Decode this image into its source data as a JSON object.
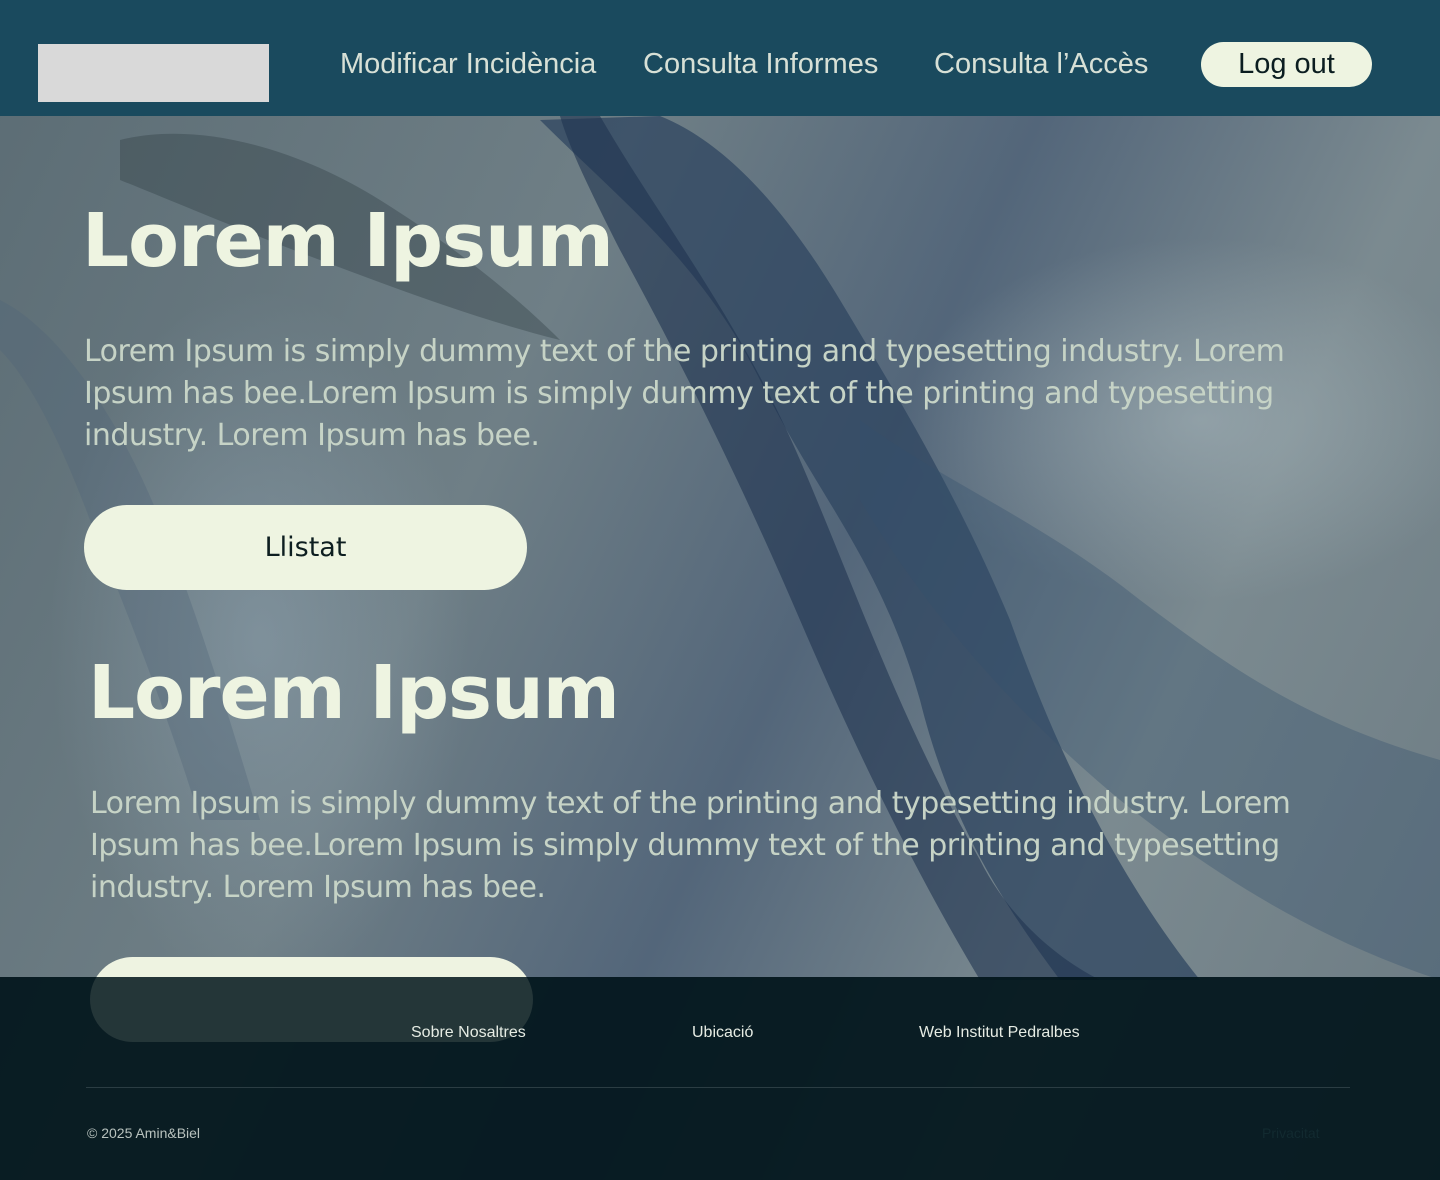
{
  "header": {
    "nav": [
      {
        "label": "Modificar Incidència"
      },
      {
        "label": "Consulta Informes"
      },
      {
        "label": "Consulta l’Accès"
      }
    ],
    "logout_label": "Log out"
  },
  "sections": [
    {
      "title": "Lorem Ipsum",
      "text": "Lorem Ipsum is simply dummy text of the printing and typesetting industry. Lorem Ipsum has bee.Lorem Ipsum is simply dummy text of the printing and typesetting industry. Lorem Ipsum has bee.",
      "button_label": "Llistat"
    },
    {
      "title": "Lorem Ipsum",
      "text": "Lorem Ipsum is simply dummy text of the printing and typesetting industry. Lorem Ipsum has bee.Lorem Ipsum is simply dummy text of the printing and typesetting industry. Lorem Ipsum has bee.",
      "button_label": ""
    }
  ],
  "footer": {
    "links": [
      {
        "label": "Sobre Nosaltres"
      },
      {
        "label": "Ubicació"
      },
      {
        "label": "Web Institut Pedralbes"
      }
    ],
    "copyright": "© 2025 Amin&Biel",
    "privacy": "Privacitat"
  },
  "colors": {
    "header_bg": "#1a4a5e",
    "accent_light": "#eef4e1",
    "footer_bg": "#02161c"
  }
}
